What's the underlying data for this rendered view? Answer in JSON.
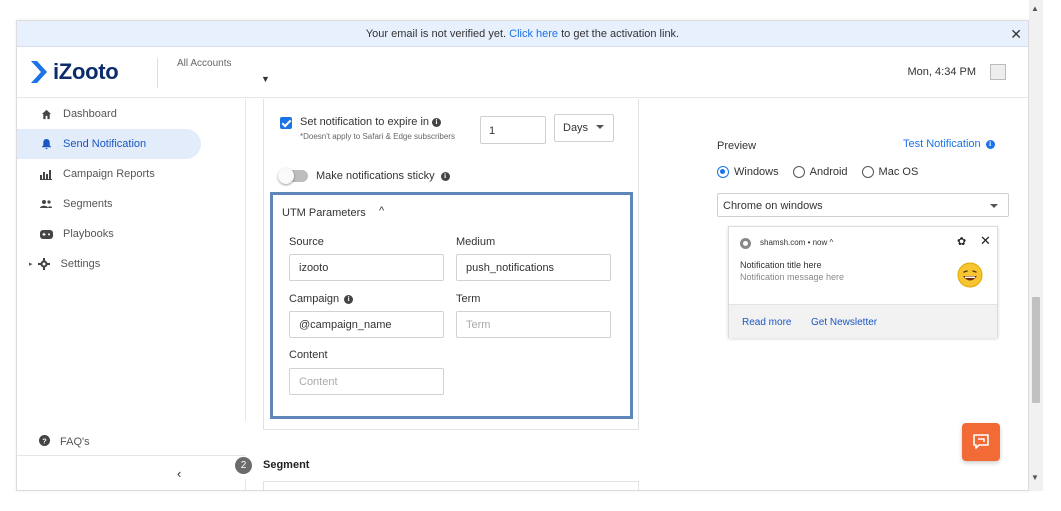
{
  "banner": {
    "text_before": "Your email is not verified yet. ",
    "link": "Click here",
    "text_after": " to get the activation link.",
    "close": "✕"
  },
  "header": {
    "logo_text": "iZooto",
    "accounts_label": "All Accounts",
    "datetime": "Mon, 4:34 PM"
  },
  "sidebar": {
    "items": [
      {
        "label": "Dashboard",
        "icon": "home-icon"
      },
      {
        "label": "Send Notification",
        "icon": "bell-icon",
        "active": true
      },
      {
        "label": "Campaign Reports",
        "icon": "bar-chart-icon"
      },
      {
        "label": "Segments",
        "icon": "people-icon"
      },
      {
        "label": "Playbooks",
        "icon": "gamepad-icon"
      },
      {
        "label": "Settings",
        "icon": "gear-icon"
      }
    ],
    "faq_label": "FAQ's",
    "collapse": "‹"
  },
  "expire": {
    "label": "Set notification to expire in",
    "sub": "*Doesn't apply to Safari & Edge subscribers",
    "value": "1",
    "unit": "Days"
  },
  "sticky": {
    "label": "Make notifications sticky",
    "enabled": false
  },
  "utm": {
    "title": "UTM Parameters",
    "caret": "^",
    "source_label": "Source",
    "source_value": "izooto",
    "medium_label": "Medium",
    "medium_value": "push_notifications",
    "campaign_label": "Campaign",
    "campaign_value": "@campaign_name",
    "term_label": "Term",
    "term_placeholder": "Term",
    "content_label": "Content",
    "content_placeholder": "Content"
  },
  "segment": {
    "number": "2",
    "label": "Segment"
  },
  "preview": {
    "label": "Preview",
    "test_link": "Test Notification",
    "os_options": [
      "Windows",
      "Android",
      "Mac OS"
    ],
    "os_selected": "Windows",
    "browser": "Chrome on windows"
  },
  "notification": {
    "site": "shamsh.com • now ^",
    "title": "Notification title here",
    "message": "Notification message here",
    "actions": [
      "Read more",
      "Get Newsletter"
    ]
  },
  "colors": {
    "accent": "#1a73e8",
    "active_bg": "#e3ecfa",
    "utm_border": "#5f86b8",
    "chat_button": "#f26a36",
    "logo_text": "#0d2c6b"
  }
}
